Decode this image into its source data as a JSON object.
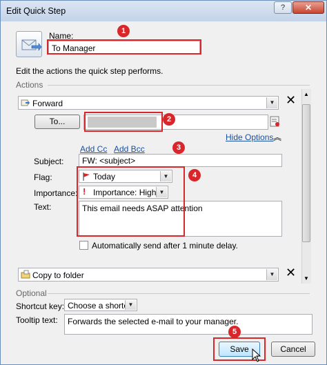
{
  "window": {
    "title": "Edit Quick Step",
    "help_label": "?",
    "close_label": "✕"
  },
  "header": {
    "name_label": "Name:",
    "name_value": "To Manager",
    "description": "Edit the actions the quick step performs."
  },
  "actions_section": {
    "label": "Actions"
  },
  "action_forward": {
    "type": "Forward",
    "to_button": "To...",
    "to_value": "",
    "hide_options": "Hide Options",
    "add_cc": "Add Cc",
    "add_bcc": "Add Bcc",
    "subject_label": "Subject:",
    "subject_value": "FW: <subject>",
    "flag_label": "Flag:",
    "flag_value": "Today",
    "importance_label": "Importance:",
    "importance_value": "Importance: High",
    "text_label": "Text:",
    "text_value": "This email needs ASAP attention",
    "auto_send_label": "Automatically send after 1 minute delay."
  },
  "action_copy": {
    "type": "Copy to folder"
  },
  "optional_section": {
    "label": "Optional",
    "shortcut_label": "Shortcut key:",
    "shortcut_value": "Choose a shortcut",
    "tooltip_label": "Tooltip text:",
    "tooltip_value": "Forwards the selected e-mail to your manager."
  },
  "footer": {
    "save": "Save",
    "cancel": "Cancel"
  },
  "annotations": {
    "b1": "1",
    "b2": "2",
    "b3": "3",
    "b4": "4",
    "b5": "5"
  },
  "colors": {
    "highlight": "#d9262b",
    "link": "#1b4fa0"
  }
}
